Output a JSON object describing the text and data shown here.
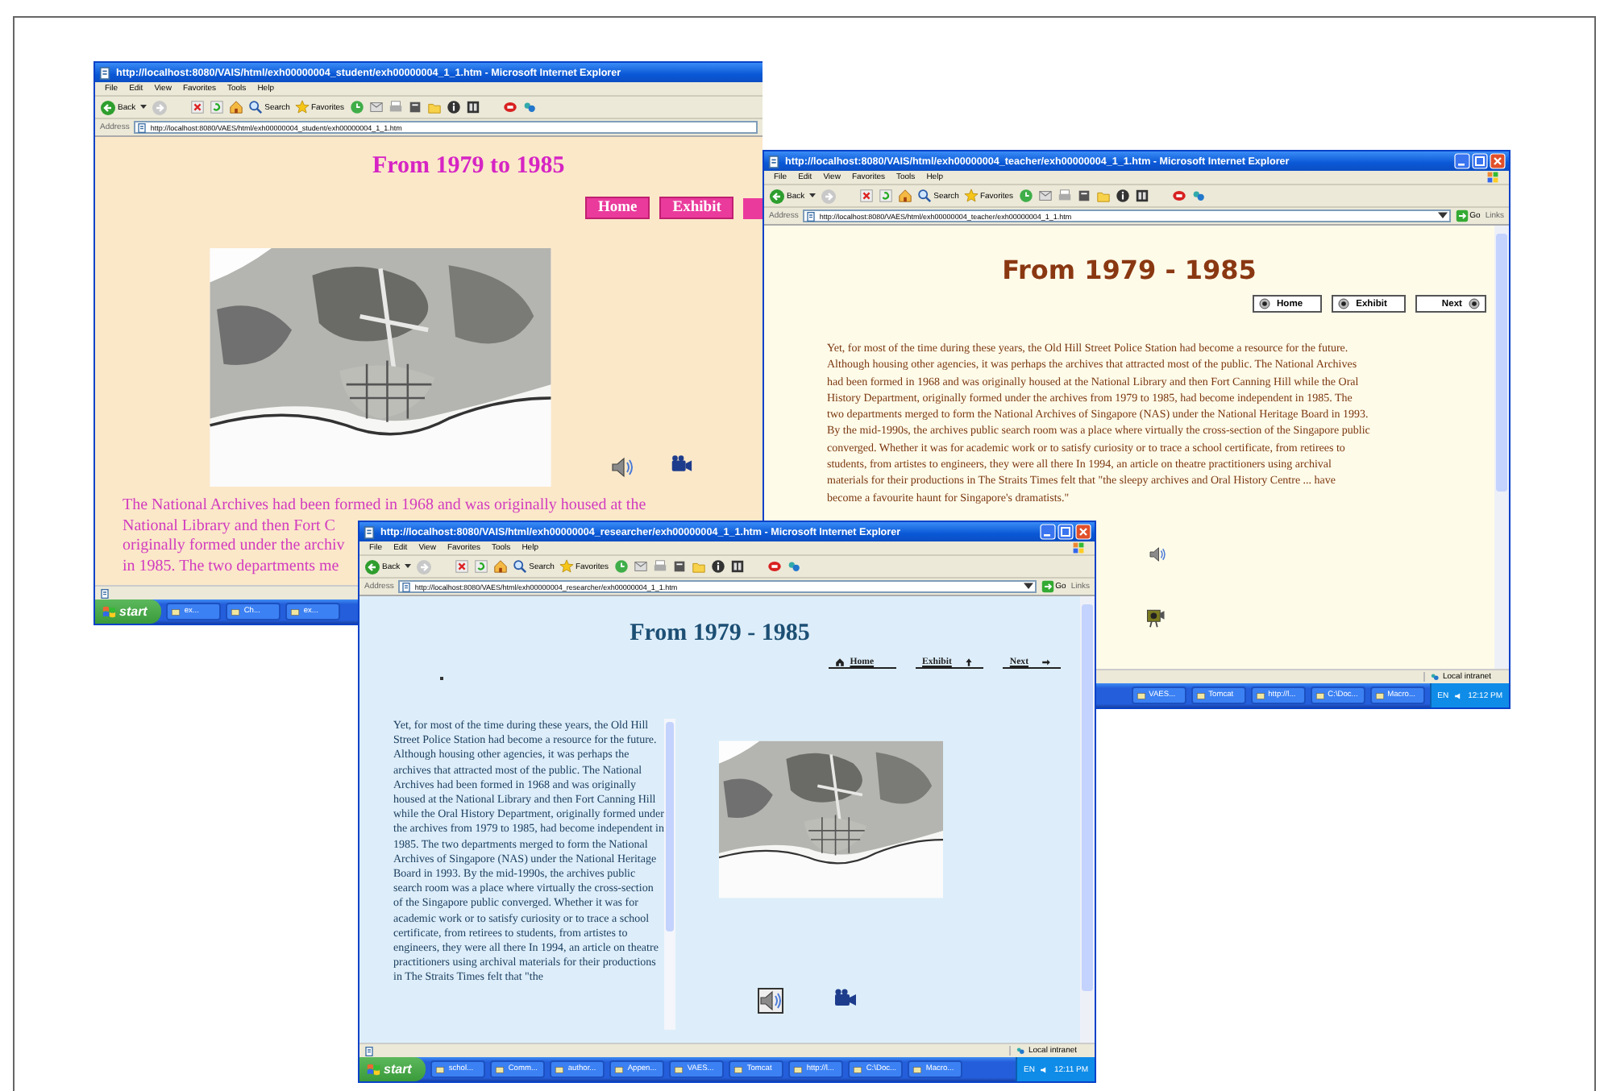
{
  "windows": [
    {
      "kind": "student",
      "title": "http://localhost:8080/VAIS/html/exh00000004_student/exh00000004_1_1.htm - Microsoft Internet Explorer",
      "menu": [
        "File",
        "Edit",
        "View",
        "Favorites",
        "Tools",
        "Help"
      ],
      "toolbar": [
        "Back",
        "Search",
        "Favorites"
      ],
      "address_label": "Address",
      "address": "http://localhost:8080/VAES/html/exh00000004_student/exh00000004_1_1.htm",
      "page": {
        "heading": "From 1979 to 1985",
        "nav": [
          "Home",
          "Exhibit"
        ],
        "lines": [
          "The National Archives had been formed in 1968 and was originally housed at the",
          "National Library and then Fort C",
          "originally formed under the archiv",
          "in 1985. The two departments me"
        ]
      },
      "taskbar": {
        "start": "start",
        "items": [
          "ex...",
          "Ch...",
          "ex..."
        ]
      }
    },
    {
      "kind": "teacher",
      "title": "http://localhost:8080/VAIS/html/exh00000004_teacher/exh00000004_1_1.htm - Microsoft Internet Explorer",
      "menu": [
        "File",
        "Edit",
        "View",
        "Favorites",
        "Tools",
        "Help"
      ],
      "toolbar": [
        "Back",
        "Search",
        "Favorites"
      ],
      "address_label": "Address",
      "address": "http://localhost:8080/VAES/html/exh00000004_teacher/exh00000004_1_1.htm",
      "go": "Go",
      "links": "Links",
      "page": {
        "heading": "From 1979 - 1985",
        "nav": [
          "Home",
          "Exhibit",
          "Next"
        ],
        "text": "Yet, for most of the time during these years, the Old Hill Street Police Station had become a resource for the future. Although housing other agencies, it was perhaps the archives that attracted most of the public. The National Archives had been formed in 1968 and was originally housed at the National Library and then Fort Canning Hill while the Oral History Department, originally formed under the archives from 1979 to 1985, had become independent in 1985. The two departments merged to form the National Archives of Singapore (NAS) under the National Heritage Board in 1993. By the mid-1990s, the archives public search room was a place where virtually the cross-section of the Singapore public converged. Whether it was for academic work or to satisfy curiosity or to trace a school certificate, from retirees to students, from artistes to engineers, they were all there In 1994, an article on theatre practitioners using archival materials for their productions in The Straits Times felt that \"the sleepy archives and Oral History Centre ... have become a favourite haunt for Singapore's dramatists.\""
      },
      "status": "Local intranet",
      "taskbar": {
        "items": [
          "VAES...",
          "Tomcat",
          "http://l...",
          "C:\\Doc...",
          "Macro..."
        ],
        "tray": {
          "lang": "EN",
          "clock": "12:12 PM"
        }
      }
    },
    {
      "kind": "researcher",
      "title": "http://localhost:8080/VAIS/html/exh00000004_researcher/exh00000004_1_1.htm - Microsoft Internet Explorer",
      "menu": [
        "File",
        "Edit",
        "View",
        "Favorites",
        "Tools",
        "Help"
      ],
      "toolbar": [
        "Back",
        "Search",
        "Favorites"
      ],
      "address_label": "Address",
      "address": "http://localhost:8080/VAES/html/exh00000004_researcher/exh00000004_1_1.htm",
      "go": "Go",
      "links": "Links",
      "page": {
        "heading": "From 1979 - 1985",
        "nav": [
          "Home",
          "Exhibit",
          "Next"
        ],
        "text": "Yet, for most of the time during these years, the Old Hill Street Police Station had become a resource for the future. Although housing other agencies, it was perhaps the archives that attracted most of the public. The National Archives had been formed in 1968 and was originally housed at the National Library and then Fort Canning Hill while the Oral History Department, originally formed under the archives from 1979 to 1985, had become independent in 1985. The two departments merged to form the National Archives of Singapore (NAS) under the National Heritage Board in 1993. By the mid-1990s, the archives public search room was a place where virtually the cross-section of the Singapore public converged. Whether it was for academic work or to satisfy curiosity or to trace a school certificate, from retirees to students, from artistes to engineers, they were all there In 1994, an article on theatre practitioners using archival materials for their productions in The Straits Times felt that \"the"
      },
      "status": "Local intranet",
      "taskbar": {
        "start": "start",
        "items": [
          "schol...",
          "Comm...",
          "author...",
          "Appen...",
          "VAES...",
          "Tomcat",
          "http://l...",
          "C:\\Doc...",
          "Macro..."
        ],
        "tray": {
          "lang": "EN",
          "clock": "12:11 PM"
        }
      }
    }
  ]
}
